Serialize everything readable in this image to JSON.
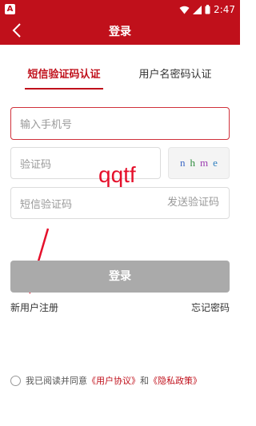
{
  "status_bar": {
    "app_badge": "A",
    "time": "2:47"
  },
  "header": {
    "title": "登录"
  },
  "tabs": [
    {
      "label": "短信验证码认证",
      "active": true
    },
    {
      "label": "用户名密码认证",
      "active": false
    }
  ],
  "form": {
    "phone_placeholder": "输入手机号",
    "captcha_placeholder": "验证码",
    "captcha_chars": [
      "n",
      "h",
      "m",
      "e"
    ],
    "captcha_colors": [
      "#3a66c4",
      "#2a8a3a",
      "#9b3bb0",
      "#2f7fc0"
    ],
    "sms_placeholder": "短信验证码",
    "send_code": "发送验证码"
  },
  "watermark_text": "qqtf",
  "login_button": "登录",
  "links": {
    "register": "新用户注册",
    "forgot_password": "忘记密码"
  },
  "agreement": {
    "prefix": "我已阅读并同意",
    "user_agreement": "《用户协议》",
    "and": "和",
    "privacy_policy": "《隐私政策》"
  },
  "colors": {
    "brand_red": "#c0101b",
    "button_disabled": "#aaaaaa"
  }
}
